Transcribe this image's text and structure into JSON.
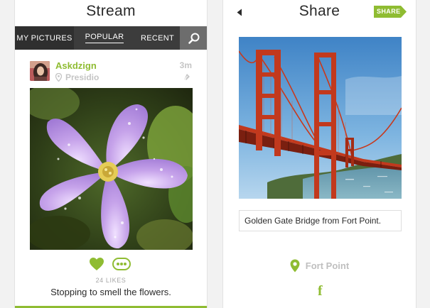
{
  "colors": {
    "accent": "#8fbc32",
    "muted": "#c5c5c5",
    "tab_bar": "#3c3c3c"
  },
  "stream": {
    "title": "Stream",
    "tabs": [
      {
        "label": "MY PICTURES"
      },
      {
        "label": "POPULAR",
        "selected": true
      },
      {
        "label": "RECENT"
      }
    ],
    "search_icon": "search-icon",
    "post": {
      "username": "Askdzign",
      "location": "Presidio",
      "time": "3m",
      "likes": "24 LIKES",
      "caption": "Stopping to smell the flowers."
    }
  },
  "share": {
    "title": "Share",
    "share_button": "SHARE",
    "caption_value": "Golden Gate Bridge from Fort Point.",
    "location": "Fort Point",
    "facebook_glyph": "f"
  }
}
